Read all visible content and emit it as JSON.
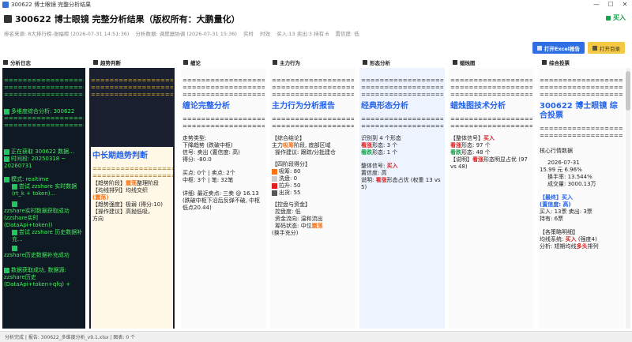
{
  "window": {
    "title": "300622 博士眼镜 完整分析结果"
  },
  "header": {
    "title": "300622 博士眼镜 完整分析结果（版权所有：大鹏量化）",
    "signal": "买入",
    "meta": [
      "排名来源: 8大排行榜-涨幅榜 (2026-07-31 14:51:36)",
      "分析数据: 调度器协调 (2026-07-31 15:36)",
      "实时",
      "时效",
      "买入:13 卖出:3 持有:6",
      "置信度: 低"
    ]
  },
  "toolbar": {
    "excel_label": "打开Excel报告",
    "dir_label": "打开目录"
  },
  "panels": {
    "log": {
      "title": "分析日志",
      "lines": [
        "==================",
        "==================",
        "==================",
        "多维度综合分析: 300622",
        "==================",
        "==================",
        "正在获取 300622 数据...",
        "时间段: 20250318 ~ 20260731",
        "模式: realtime",
        "尝试 zzshare 实时数据 (rt_k + token)...",
        "zzshare实时数据获取成功 (zzshare实时(DataApi+token))",
        "尝试 zzshare 历史数据补充...",
        "zzshare历史数据补充成功",
        "数据获取成功, 数据源: zzshare历史(DataApi+token+qfq) +"
      ]
    },
    "trend": {
      "title": "趋势判断",
      "heading": "中长期趋势判断",
      "l1a": "【趋势阶段】",
      "l1b": "震荡",
      "l1c": "整理阶段",
      "l2": "【均线排列】均线交织",
      "l2b": "(震荡)",
      "l3": "【趋势强度】极弱 (得分:10)",
      "l4": "【操作建议】高抛低吸，",
      "l4b": "方向"
    },
    "chan": {
      "title": "缠论",
      "heading": "缠论完整分析",
      "lines": [
        "走势类型:",
        "下降趋势 (跌破中枢)",
        "信号: 卖出 (置信度: 高)",
        "得分: -80.0",
        "",
        "买点: 0个 | 卖点: 2个",
        "中枢: 3个 | 笔: 32笔",
        "",
        "详细: 最近卖点: 三卖 @ 16.13",
        "(跌破中枢下沿后反弹不破, 中枢低点20.44)"
      ]
    },
    "main": {
      "title": "主力行为",
      "heading": "主力行为分析报告",
      "l1": "【综合结论】",
      "l2a": "主力",
      "l2b": "吸筹",
      "l2c": "阶段, 底部区域",
      "l3": "操作建议: 跟踪/分批建仓",
      "l4": "【四阶段得分】",
      "s1": "吸筹: 80",
      "s2": "洗盘: 0",
      "s3": "拉升: 50",
      "s4": "出货: 55",
      "l5": "【控盘与资金】",
      "l6": "控盘度: 低",
      "l7": "资金流向: 温和流出",
      "l8a": "筹码状态: 中位",
      "l8b": "震荡",
      "l9": "(换手充分)"
    },
    "pattern": {
      "title": "形态分析",
      "heading": "经典形态分析",
      "l1": "识别到 4 个形态",
      "l2a": "看涨",
      "l2b": "形态: 3 个",
      "l3a": "看跌",
      "l3b": "形态: 1 个",
      "l4a": "整体信号: ",
      "l4b": "买入",
      "l5": "置信度: 高",
      "l6a": "说明: ",
      "l6b": "看涨",
      "l6c": "形态占优 (权重 13 vs 5)"
    },
    "candle": {
      "title": "蜡烛图",
      "heading": "蜡烛图技术分析",
      "l1a": "【整体信号】",
      "l1b": "买入",
      "l2a": "看涨",
      "l2b": "形态: 97 个",
      "l3a": "看跌",
      "l3b": "形态: 48 个",
      "l4a": "【说明】",
      "l4b": "看涨",
      "l4c": "形态明显占优 (97 vs 48)"
    },
    "vote": {
      "title": "综合投票",
      "heading": "300622 博士眼镜 综合投票",
      "l1": "核心行情数据",
      "date": "2026-07-31",
      "price": "15.99 元",
      "pct": "6.96%",
      "turnover": "换手率: 13.544%",
      "volume": "成交量: 3000.13万",
      "final_a": "【最终】",
      "final_b": "买入",
      "final_c": "(置信度: 高)",
      "votes_a": "买入: 13票",
      "votes_b": "卖出: 3票",
      "votes_c": "持有: 6票",
      "l8": "【各策略明细】",
      "l9a": "均线系统: ",
      "l9b": "买入",
      "l9c": " (强度4)",
      "l10a": "分析: 短期均线",
      "l10b": "多头",
      "l10c": "排列"
    }
  },
  "status": {
    "text": "分析完成 | 报告: 300622_多维度分析_v9.1.xlsx | 图表: 0 个"
  },
  "colors": {
    "buy": "#e11d1d",
    "accent": "#2563eb",
    "log_green": "#3ef05c"
  }
}
